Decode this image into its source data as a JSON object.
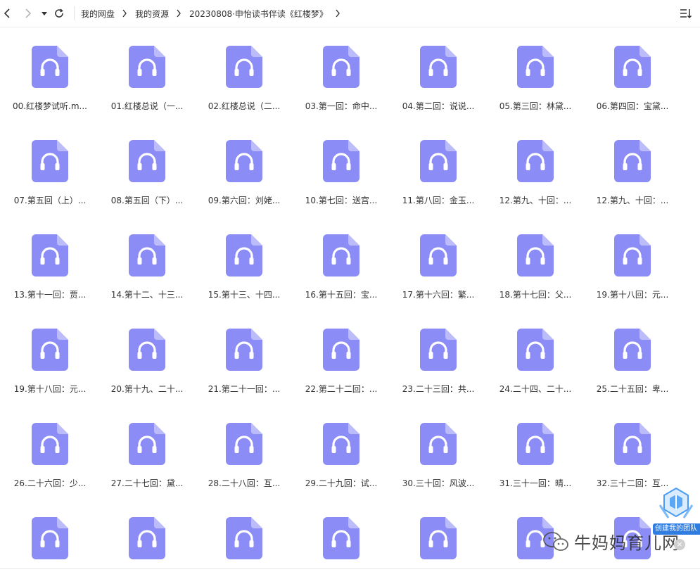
{
  "colors": {
    "file_icon": "#8c8cf6",
    "file_icon_fold": "#bcbcfb",
    "headphone": "#ffffff",
    "team_label_bg": "#2f7de1"
  },
  "toolbar": {
    "back_icon": "chevron-left-icon",
    "forward_icon": "chevron-right-icon",
    "history_icon": "triangle-down-icon",
    "refresh_icon": "refresh-icon",
    "sort_icon": "sort-list-icon"
  },
  "breadcrumb": [
    {
      "label": "我的网盘"
    },
    {
      "label": "我的资源"
    },
    {
      "label": "20230808·申怡读书伴读《红楼梦》"
    }
  ],
  "files": [
    {
      "name": "00.红楼梦试听.m..."
    },
    {
      "name": "01.红楼总说（一..."
    },
    {
      "name": "02.红楼总说（二..."
    },
    {
      "name": "03.第一回：命中..."
    },
    {
      "name": "04.第二回：说说..."
    },
    {
      "name": "05.第三回：林黛..."
    },
    {
      "name": "06.第四回：宝黛..."
    },
    {
      "name": "07.第五回（上）..."
    },
    {
      "name": "08.第五回（下）..."
    },
    {
      "name": "09.第六回：刘姥..."
    },
    {
      "name": "10.第七回：送宫..."
    },
    {
      "name": "11.第八回：金玉..."
    },
    {
      "name": "12.第九、十回：..."
    },
    {
      "name": "12.第九、十回：..."
    },
    {
      "name": "13.第十一回：贾..."
    },
    {
      "name": "14.第十二、十三..."
    },
    {
      "name": "15.第十三、十四..."
    },
    {
      "name": "16.第十五回：宝..."
    },
    {
      "name": "17.第十六回：繁..."
    },
    {
      "name": "18.第十七回：父..."
    },
    {
      "name": "19.第十八回：元..."
    },
    {
      "name": "19.第十八回：元..."
    },
    {
      "name": "20.第十九、二十..."
    },
    {
      "name": "21.第二十一回：..."
    },
    {
      "name": "22.第二十二回：..."
    },
    {
      "name": "23.二十三回：共..."
    },
    {
      "name": "24.二十四、二十..."
    },
    {
      "name": "25.二十五回：卑..."
    },
    {
      "name": "26.二十六回：少..."
    },
    {
      "name": "27.二十七回：黛..."
    },
    {
      "name": "28.二十八回：互..."
    },
    {
      "name": "29.二十九回：试..."
    },
    {
      "name": "30.三十回：风波..."
    },
    {
      "name": "31.三十一回：晴..."
    },
    {
      "name": "32.三十二回：互..."
    },
    {
      "name": ""
    },
    {
      "name": ""
    },
    {
      "name": ""
    },
    {
      "name": ""
    },
    {
      "name": ""
    },
    {
      "name": ""
    },
    {
      "name": ""
    }
  ],
  "file_icon_name": "audio-file-icon",
  "team_widget": {
    "label": "创建我的团队",
    "close": "×",
    "icon": "team-logo-icon"
  },
  "watermark": {
    "text": "牛妈妈育儿网",
    "icon": "wechat-icon"
  }
}
